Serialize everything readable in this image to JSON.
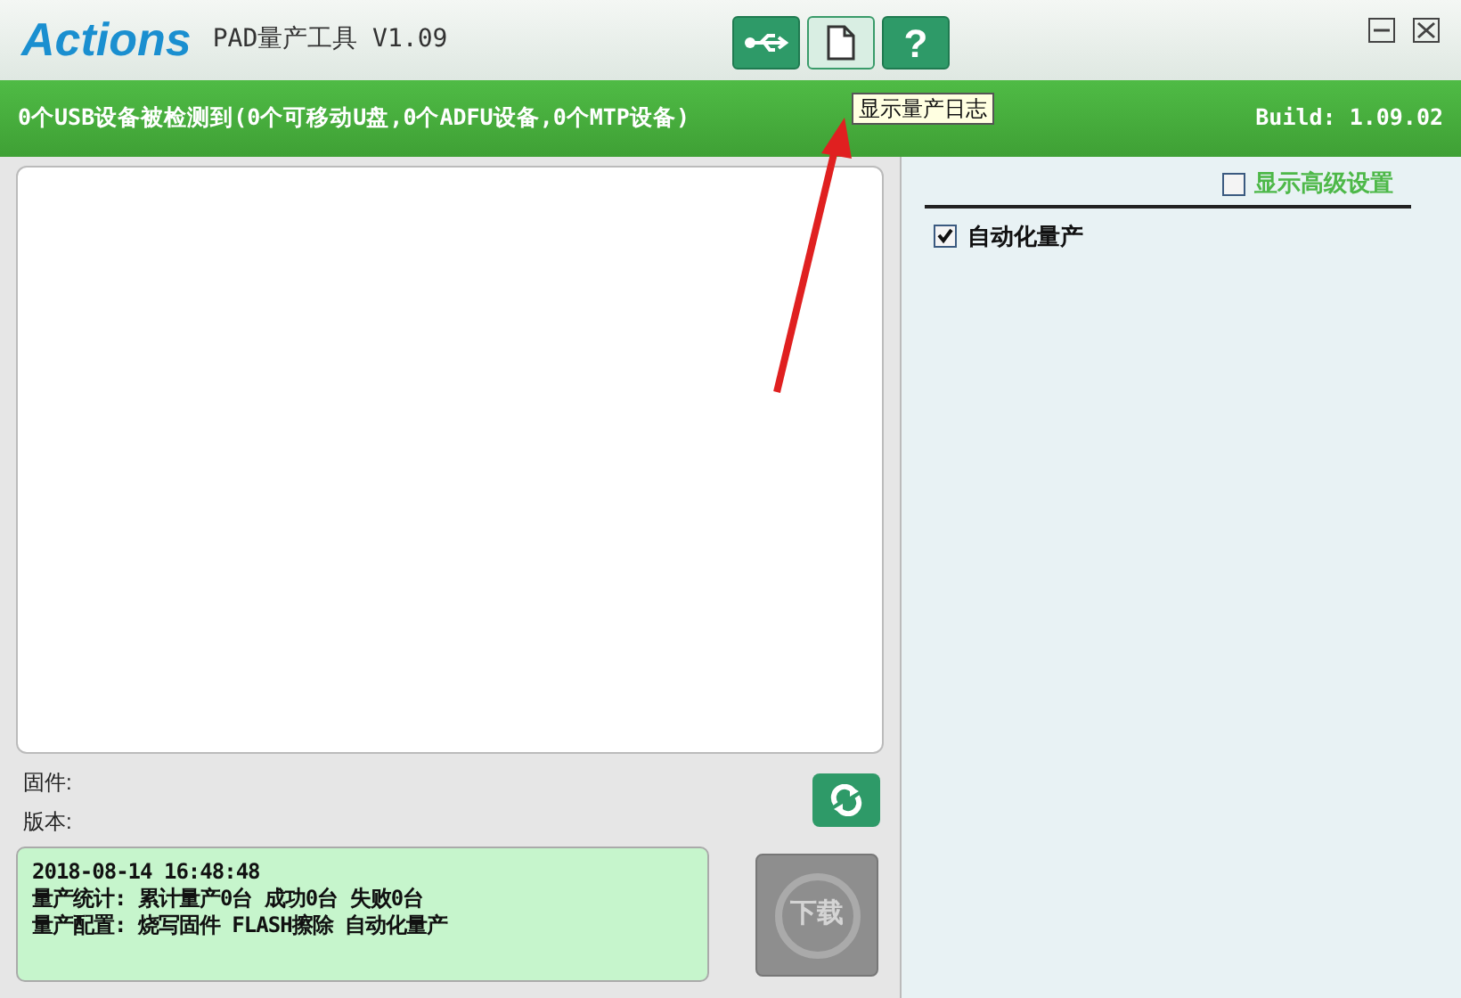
{
  "window": {
    "logo": "Actions",
    "title": "PAD量产工具 V1.09"
  },
  "toolbar": [
    {
      "kind": "usb",
      "selected": false
    },
    {
      "kind": "log",
      "selected": true
    },
    {
      "kind": "help",
      "label": "?",
      "selected": false
    }
  ],
  "tooltip": "显示量产日志",
  "status_bar": {
    "message": "0个USB设备被检测到(0个可移动U盘,0个ADFU设备,0个MTP设备)",
    "build": "Build: 1.09.02"
  },
  "firmware": {
    "firmware_label": "固件:",
    "version_label": "版本:"
  },
  "log": [
    "2018-08-14 16:48:48",
    "量产统计: 累计量产0台 成功0台 失败0台",
    "量产配置: 烧写固件 FLASH擦除 自动化量产"
  ],
  "download": {
    "label": "下载",
    "disabled": true
  },
  "settings": {
    "advanced": {
      "label": "显示高级设置",
      "checked": false
    },
    "options": [
      {
        "label": "自动化量产",
        "checked": true
      }
    ]
  }
}
